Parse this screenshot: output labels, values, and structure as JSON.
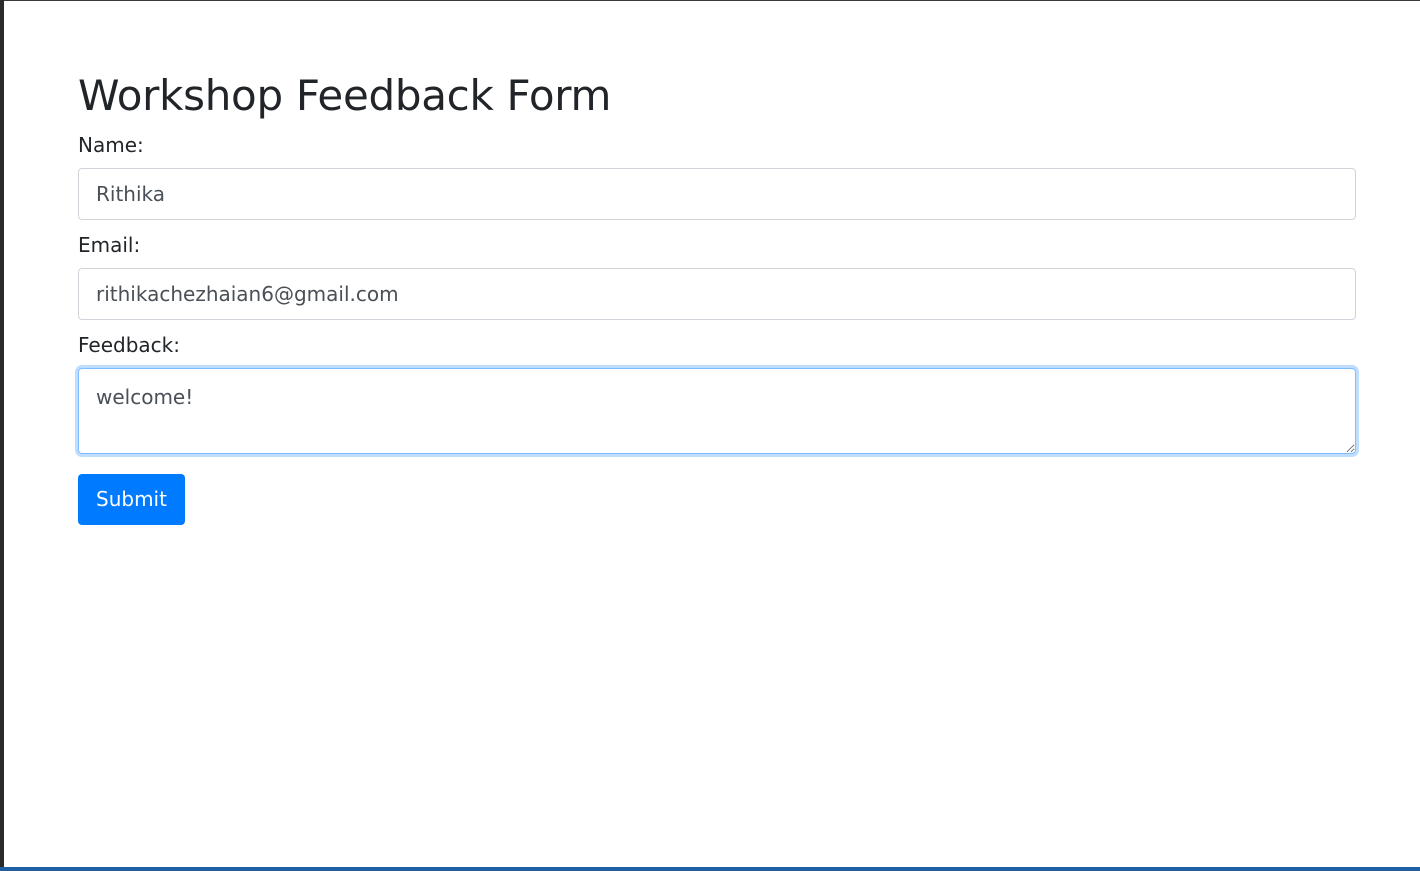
{
  "form": {
    "title": "Workshop Feedback Form",
    "name_label": "Name:",
    "name_value": "Rithika",
    "email_label": "Email:",
    "email_value": "rithikachezhaian6@gmail.com",
    "feedback_label": "Feedback:",
    "feedback_value": "welcome!",
    "submit_label": "Submit"
  },
  "colors": {
    "primary": "#007bff",
    "text": "#212529",
    "input_text": "#495057",
    "input_border": "#ced4da",
    "focus_border": "#80bdff"
  }
}
